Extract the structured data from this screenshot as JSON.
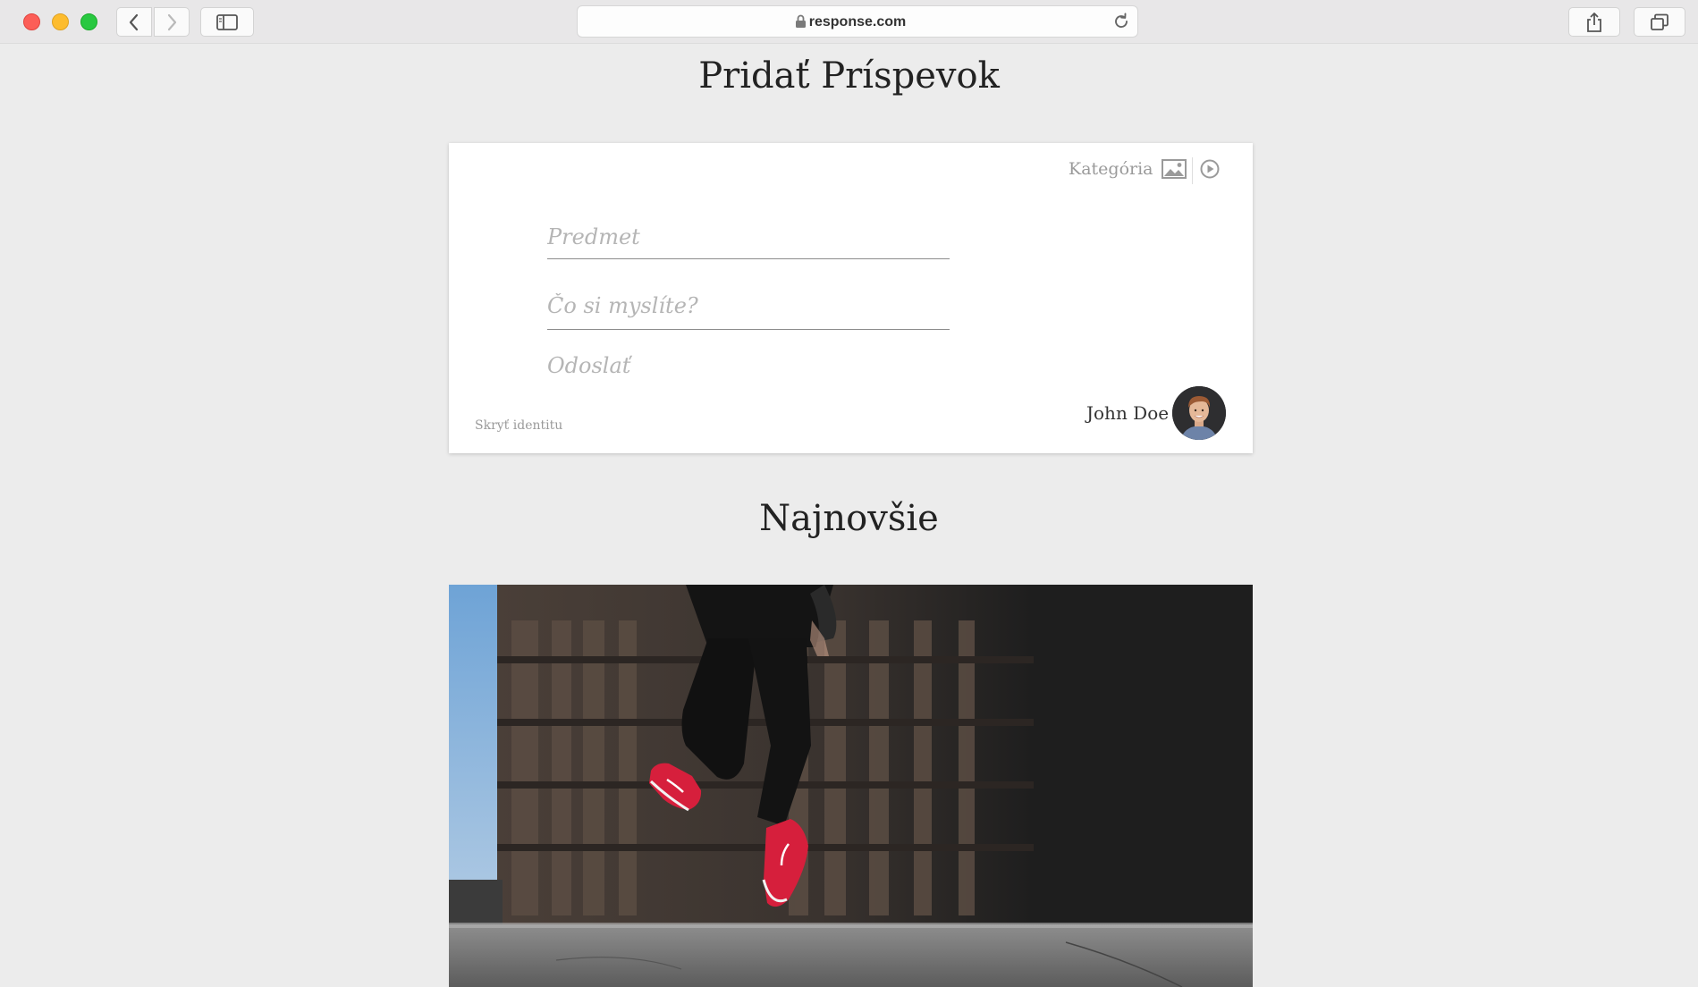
{
  "browser": {
    "url": "response.com"
  },
  "page": {
    "title": "Pridať Príspevok"
  },
  "composer": {
    "category_label": "Kategória",
    "subject_placeholder": "Predmet",
    "thought_placeholder": "Čo si myslíte?",
    "submit_label": "Odoslať",
    "hide_identity_label": "Skryť identitu",
    "user_name": "John Doe",
    "icons": [
      "image-icon",
      "play-icon"
    ]
  },
  "feed": {
    "title": "Najnovšie"
  },
  "colors": {
    "background": "#ececec",
    "card": "#ffffff",
    "muted_text": "#9a9a9a",
    "sneaker_red": "#d61f3c"
  }
}
